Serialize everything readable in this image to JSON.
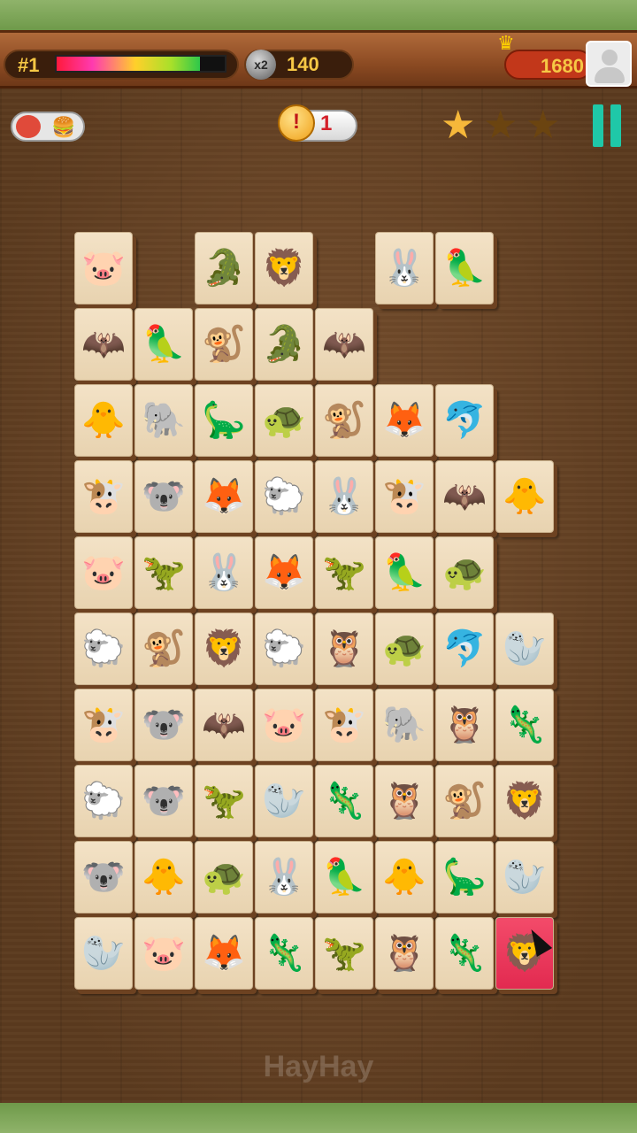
{
  "hud": {
    "level_label": "#1",
    "time_remaining": 0.85,
    "multiplier_icon": "x2-icon",
    "score": "140",
    "coins": "1680"
  },
  "toolbar": {
    "hint_count": "1",
    "stars_earned": 1,
    "stars_total": 3
  },
  "brand": "HayHay",
  "colors": {
    "tile_face": "#f3e2c6",
    "selected_tile": "#e22a50",
    "pause_button": "#1fc8a8",
    "star_gold": "#f6b83a"
  },
  "board": {
    "rows": [
      [
        "pig",
        null,
        "crocodile",
        "lion",
        null,
        "rabbit",
        "parrot",
        null
      ],
      [
        "bat",
        "parrot",
        "monkey",
        "crocodile",
        "bat",
        null,
        null,
        null
      ],
      [
        "duck",
        "elephant",
        "triceratops",
        "turtle",
        "monkey",
        "fox",
        "dolphin",
        null
      ],
      [
        "cow",
        "koala",
        "fox",
        "sheep",
        "rabbit",
        "cow",
        "bat",
        "duck"
      ],
      [
        "pig",
        "stegosaurus",
        "rabbit",
        "fox",
        "stegosaurus",
        "parrot",
        "turtle",
        null
      ],
      [
        "sheep",
        "monkey",
        "lion",
        "sheep",
        "owl",
        "turtle",
        "dolphin",
        "seal"
      ],
      [
        "cow",
        "koala",
        "bat",
        "pig",
        "cow",
        "elephant",
        "owl",
        "chameleon"
      ],
      [
        "sheep",
        "koala",
        "stegosaurus",
        "seal",
        "chameleon",
        "owl",
        "monkey",
        "lion"
      ],
      [
        "koala",
        "duck",
        "turtle",
        "rabbit",
        "parrot",
        "duck",
        "triceratops",
        "seal"
      ],
      [
        "seal",
        "pig",
        "fox",
        "chameleon",
        "stegosaurus",
        "owl",
        "chameleon",
        "lion"
      ]
    ],
    "selected": {
      "row": 9,
      "col": 7
    }
  }
}
